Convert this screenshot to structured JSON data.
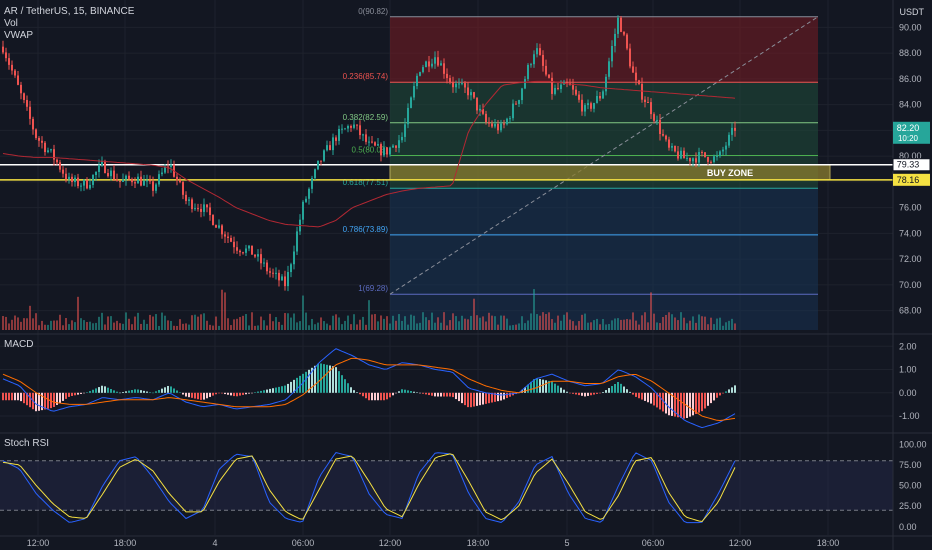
{
  "header": {
    "symbol_line": "AR / TetherUS, 15, BINANCE",
    "indicator_1": "Vol",
    "indicator_2": "VWAP",
    "currency": "USDT"
  },
  "panes": {
    "macd_title": "MACD",
    "stoch_title": "Stoch RSI"
  },
  "colors": {
    "background": "#131722",
    "up": "#26a69a",
    "down": "#ef5350",
    "grid": "#1e222d",
    "macd_line": "#2962ff",
    "signal_line": "#ff6d00",
    "stoch_k": "#2962ff",
    "stoch_d": "#f5e142",
    "vwap": "#b22833",
    "fib_red": "#7a1c22",
    "fib_green": "#1f4d3a",
    "fib_blue": "#173456",
    "buy_zone_fill": "#8a7d2e",
    "price_tag": "#26a69a"
  },
  "chart_data": [
    {
      "type": "candlestick",
      "title": "AR / TetherUS, 15, BINANCE",
      "ylabel": "USDT",
      "ylim": [
        66.5,
        91.5
      ],
      "y_ticks": [
        "90.00",
        "88.00",
        "86.00",
        "84.00",
        "82.00",
        "80.00",
        "78.00",
        "76.00",
        "74.00",
        "72.00",
        "70.00",
        "68.00"
      ],
      "x_ticks": [
        "12:00",
        "18:00",
        "4",
        "06:00",
        "12:00",
        "18:00",
        "5",
        "06:00",
        "12:00",
        "18:00"
      ],
      "close_path": [
        88.5,
        85,
        81.5,
        80,
        78,
        77.8,
        79.3,
        78,
        78.3,
        77.5,
        79.5,
        76.5,
        76,
        74.5,
        73,
        72.5,
        71,
        70,
        76,
        79.5,
        81.5,
        82.5,
        80.8,
        80.3,
        81.5,
        86.8,
        87.8,
        85.6,
        85,
        82.6,
        82.1,
        84.6,
        88.5,
        85,
        85.5,
        83.5,
        84.8,
        90.8,
        85.7,
        83.5,
        80.5,
        79.8,
        80,
        79.8,
        82.2
      ],
      "current_price": {
        "value": 82.2,
        "label": "82.20",
        "countdown": "10:20"
      },
      "price_tags": [
        {
          "value": 79.33,
          "label": "79.33",
          "style": "white"
        },
        {
          "value": 78.16,
          "label": "78.16",
          "style": "yellow"
        }
      ],
      "horizontal_lines": [
        {
          "value": 79.33,
          "color": "white"
        },
        {
          "value": 78.16,
          "color": "yellow"
        }
      ],
      "buy_zone": {
        "label": "BUY ZONE",
        "from": 78.16,
        "to": 79.33
      },
      "fibonacci": {
        "high": 90.82,
        "low": 69.28,
        "levels": [
          {
            "ratio": 0,
            "label": "0(90.82)",
            "value": 90.82
          },
          {
            "ratio": 0.236,
            "label": "0.236(85.74)",
            "value": 85.74
          },
          {
            "ratio": 0.382,
            "label": "0.382(82.59)",
            "value": 82.59
          },
          {
            "ratio": 0.5,
            "label": "0.5(80.05)",
            "value": 80.05
          },
          {
            "ratio": 0.618,
            "label": "0.618(77.51)",
            "value": 77.51
          },
          {
            "ratio": 0.786,
            "label": "0.786(73.89)",
            "value": 73.89
          },
          {
            "ratio": 1,
            "label": "1(69.28)",
            "value": 69.28
          }
        ]
      },
      "vwap_path": [
        80.2,
        80.0,
        79.9,
        79.9,
        79.8,
        79.7,
        79.6,
        79.5,
        79.4,
        79.3,
        79.1,
        78.2,
        77.5,
        76.8,
        76,
        75.5,
        75,
        74.7,
        74.6,
        74.5,
        75,
        76,
        76.5,
        77,
        77.3,
        77.5,
        77.6,
        77.7,
        82,
        84,
        85.5,
        85.7,
        85.8,
        85.8,
        85.6,
        85.5,
        85.3,
        85.2,
        85.1,
        85.0,
        84.9,
        84.8,
        84.7,
        84.6,
        84.5
      ],
      "series": [
        {
          "name": "Vol",
          "type": "volume"
        },
        {
          "name": "VWAP",
          "type": "line"
        }
      ]
    },
    {
      "type": "macd",
      "title": "MACD",
      "ylim": [
        -1.6,
        2.4
      ],
      "y_ticks": [
        "2.00",
        "1.00",
        "0.00",
        "-1.00"
      ],
      "macd_path": [
        0.6,
        0.3,
        -0.5,
        -0.8,
        -0.6,
        -0.5,
        -0.2,
        -0.3,
        -0.2,
        -0.3,
        0.0,
        -0.4,
        -0.6,
        -0.5,
        -0.7,
        -0.6,
        -0.5,
        -0.3,
        0.4,
        1.3,
        1.9,
        1.6,
        1.2,
        1.0,
        1.3,
        1.2,
        1.0,
        0.9,
        0.2,
        0.0,
        -0.1,
        0.0,
        0.6,
        0.8,
        0.5,
        0.3,
        0.4,
        1.0,
        0.7,
        0.2,
        -0.6,
        -1.2,
        -1.5,
        -1.3,
        -0.9
      ],
      "signal_path": [
        0.8,
        0.5,
        0.0,
        -0.4,
        -0.5,
        -0.5,
        -0.4,
        -0.3,
        -0.3,
        -0.3,
        -0.2,
        -0.3,
        -0.4,
        -0.5,
        -0.6,
        -0.6,
        -0.6,
        -0.5,
        -0.1,
        0.5,
        1.2,
        1.5,
        1.4,
        1.2,
        1.2,
        1.2,
        1.1,
        1.0,
        0.6,
        0.3,
        0.1,
        0.0,
        0.2,
        0.5,
        0.5,
        0.4,
        0.4,
        0.7,
        0.8,
        0.5,
        0.0,
        -0.5,
        -1.0,
        -1.2,
        -1.1
      ],
      "series": [
        {
          "name": "MACD"
        }
      ]
    },
    {
      "type": "stoch_rsi",
      "title": "Stoch RSI",
      "ylim": [
        -10,
        110
      ],
      "y_ticks": [
        "100.00",
        "75.00",
        "50.00",
        "25.00",
        "0.00"
      ],
      "bands": [
        80,
        20
      ],
      "k_path": [
        80,
        70,
        40,
        20,
        5,
        10,
        50,
        80,
        85,
        60,
        30,
        10,
        20,
        70,
        88,
        85,
        30,
        10,
        5,
        60,
        90,
        85,
        40,
        15,
        10,
        65,
        90,
        88,
        40,
        10,
        5,
        30,
        75,
        85,
        40,
        10,
        5,
        50,
        90,
        80,
        30,
        5,
        5,
        40,
        80
      ],
      "d_path": [
        78,
        75,
        50,
        28,
        12,
        10,
        40,
        72,
        82,
        68,
        40,
        18,
        18,
        55,
        82,
        86,
        45,
        18,
        8,
        45,
        82,
        86,
        55,
        22,
        12,
        52,
        84,
        89,
        55,
        18,
        8,
        25,
        65,
        82,
        52,
        18,
        8,
        38,
        80,
        84,
        42,
        12,
        6,
        30,
        72
      ],
      "series": [
        {
          "name": "Stoch RSI"
        }
      ]
    }
  ]
}
